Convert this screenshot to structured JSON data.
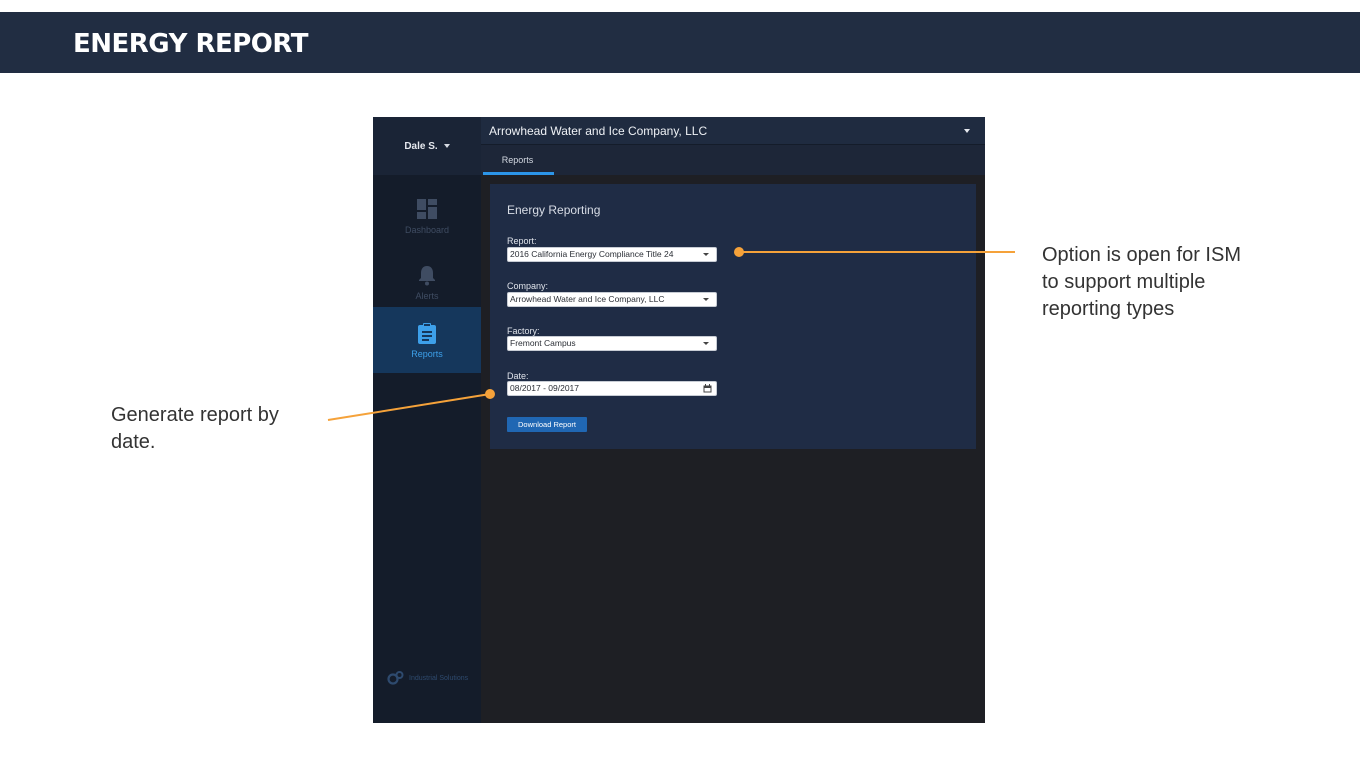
{
  "slide": {
    "title": "ENERGY REPORT"
  },
  "colors": {
    "banner": "#212d42",
    "accent_orange": "#f5a23a",
    "app_accent": "#2c95e8"
  },
  "app": {
    "user": {
      "name": "Dale S."
    },
    "company": "Arrowhead Water and Ice Company, LLC",
    "tabs": [
      {
        "label": "Reports",
        "active": true
      }
    ],
    "nav": [
      {
        "label": "Dashboard",
        "icon": "dashboard-icon",
        "active": false
      },
      {
        "label": "Alerts",
        "icon": "bell-icon",
        "active": false
      },
      {
        "label": "Reports",
        "icon": "clipboard-icon",
        "active": true
      }
    ],
    "brand": "Industrial Solutions",
    "panel": {
      "title": "Energy Reporting",
      "report": {
        "label": "Report:",
        "value": "2016 California Energy Compliance Title 24"
      },
      "company": {
        "label": "Company:",
        "value": "Arrowhead Water and Ice Company, LLC"
      },
      "factory": {
        "label": "Factory:",
        "value": "Fremont Campus"
      },
      "date": {
        "label": "Date:",
        "value": "08/2017 - 09/2017"
      },
      "download_label": "Download Report"
    }
  },
  "annotations": {
    "right": "Option is open for ISM to support multiple reporting types",
    "left": "Generate report by date."
  }
}
